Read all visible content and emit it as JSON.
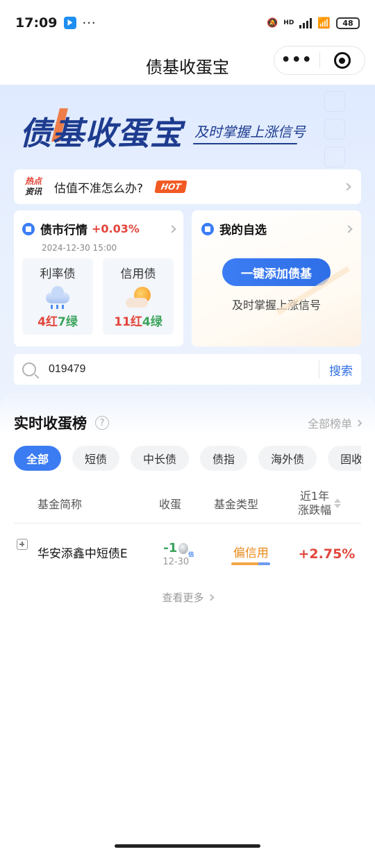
{
  "status_bar": {
    "time": "17:09",
    "network": "HD",
    "battery": "48"
  },
  "nav": {
    "title": "债基收蛋宝"
  },
  "hero": {
    "logo": "债基收蛋宝",
    "slogan": "及时掌握上涨信号"
  },
  "news": {
    "tag_line1": "热点",
    "tag_line2": "资讯",
    "text": "估值不准怎么办?",
    "badge": "HOT"
  },
  "market": {
    "title": "债市行情",
    "change": "+0.03%",
    "date": "2024-12-30 15:00",
    "rate": {
      "name": "利率债",
      "red": "4红",
      "green": "7绿"
    },
    "credit": {
      "name": "信用债",
      "red": "11红",
      "green": "4绿"
    }
  },
  "favorites": {
    "title": "我的自选",
    "button": "一键添加债基",
    "subtitle": "及时掌握上涨信号"
  },
  "search": {
    "value": "019479",
    "button": "搜索"
  },
  "ranking": {
    "title": "实时收蛋榜",
    "help": "?",
    "all": "全部榜单",
    "tabs": [
      "全部",
      "短债",
      "中长债",
      "债指",
      "海外债",
      "固收+"
    ],
    "headers": {
      "name": "基金简称",
      "egg": "收蛋",
      "type": "基金类型",
      "change_line1": "近1年",
      "change_line2": "涨跌幅"
    },
    "rows": [
      {
        "name": "华安添鑫中短债E",
        "egg": "-1",
        "date": "12-30",
        "type": "偏信用",
        "change": "+2.75%"
      }
    ],
    "more": "查看更多"
  }
}
